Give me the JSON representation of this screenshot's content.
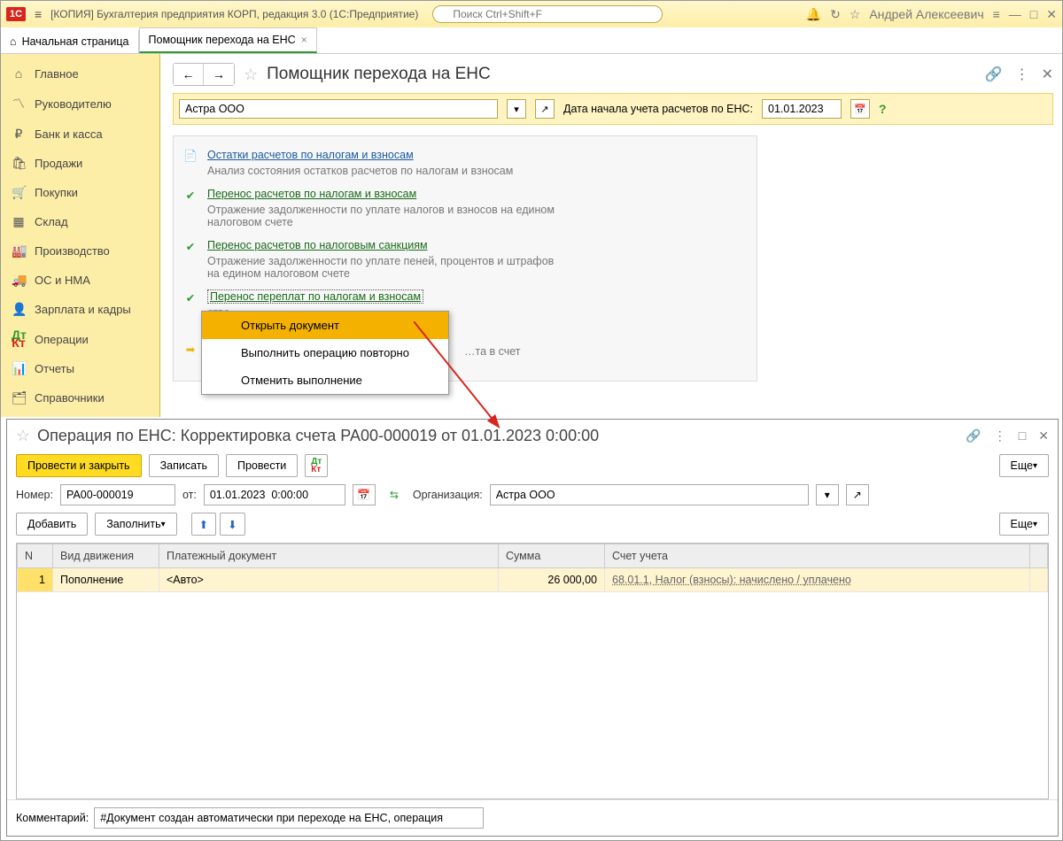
{
  "topbar": {
    "title": "[КОПИЯ] Бухгалтерия предприятия КОРП, редакция 3.0  (1С:Предприятие)",
    "search_placeholder": "Поиск Ctrl+Shift+F",
    "user": "Андрей Алексеевич"
  },
  "tabs": {
    "home": "Начальная страница",
    "active": "Помощник перехода на ЕНС"
  },
  "sidebar": {
    "items": [
      {
        "label": "Главное"
      },
      {
        "label": "Руководителю"
      },
      {
        "label": "Банк и касса"
      },
      {
        "label": "Продажи"
      },
      {
        "label": "Покупки"
      },
      {
        "label": "Склад"
      },
      {
        "label": "Производство"
      },
      {
        "label": "ОС и НМА"
      },
      {
        "label": "Зарплата и кадры"
      },
      {
        "label": "Операции"
      },
      {
        "label": "Отчеты"
      },
      {
        "label": "Справочники"
      }
    ]
  },
  "page": {
    "title": "Помощник перехода на ЕНС",
    "org_value": "Астра ООО",
    "date_label": "Дата начала учета расчетов по ЕНС:",
    "date_value": "01.01.2023"
  },
  "steps": [
    {
      "link": "Остатки расчетов по налогам и взносам",
      "desc": "Анализ состояния остатков расчетов по налогам и взносам"
    },
    {
      "link": "Перенос расчетов по налогам и взносам",
      "desc": "Отражение задолженности по уплате налогов и взносов на едином налоговом счете"
    },
    {
      "link": "Перенос расчетов по налоговым санкциям",
      "desc": "Отражение задолженности по уплате пеней, процентов и штрафов на едином налоговом счете"
    },
    {
      "link": "Перенос переплат по налогам и взносам",
      "desc": "…"
    },
    {
      "link": "",
      "desc": "…та в счет"
    }
  ],
  "context_menu": {
    "open": "Открыть документ",
    "redo": "Выполнить операцию повторно",
    "cancel": "Отменить выполнение"
  },
  "win2": {
    "title": "Операция по ЕНС: Корректировка счета РА00-000019 от 01.01.2023 0:00:00",
    "buttons": {
      "post_close": "Провести и закрыть",
      "save": "Записать",
      "post": "Провести",
      "more": "Еще"
    },
    "fields": {
      "num_label": "Номер:",
      "num_value": "РА00-000019",
      "from_label": "от:",
      "date_value": "01.01.2023  0:00:00",
      "org_label": "Организация:",
      "org_value": "Астра ООО",
      "add": "Добавить",
      "fill": "Заполнить",
      "comment_label": "Комментарий:",
      "comment_value": "#Документ создан автоматически при переходе на ЕНС, операция"
    },
    "table": {
      "headers": {
        "n": "N",
        "kind": "Вид движения",
        "doc": "Платежный документ",
        "sum": "Сумма",
        "account": "Счет учета"
      },
      "rows": [
        {
          "n": "1",
          "kind": "Пополнение",
          "doc": "<Авто>",
          "sum": "26 000,00",
          "account": "68.01.1, Налог (взносы): начислено / уплачено"
        }
      ]
    }
  }
}
